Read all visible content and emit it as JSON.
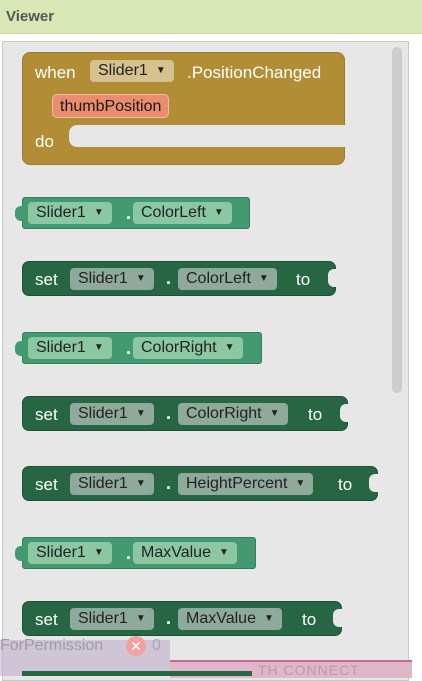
{
  "viewer": {
    "title": "Viewer"
  },
  "event_block": {
    "when": "when",
    "component": "Slider1",
    "event": ".PositionChanged",
    "param": "thumbPosition",
    "do": "do"
  },
  "blocks": [
    {
      "kind": "getter",
      "component": "Slider1",
      "property": "ColorLeft"
    },
    {
      "kind": "setter",
      "set": "set",
      "component": "Slider1",
      "property": "ColorLeft",
      "to": "to"
    },
    {
      "kind": "getter",
      "component": "Slider1",
      "property": "ColorRight"
    },
    {
      "kind": "setter",
      "set": "set",
      "component": "Slider1",
      "property": "ColorRight",
      "to": "to"
    },
    {
      "kind": "setter",
      "set": "set",
      "component": "Slider1",
      "property": "HeightPercent",
      "to": "to"
    },
    {
      "kind": "getter",
      "component": "Slider1",
      "property": "MaxValue"
    },
    {
      "kind": "setter",
      "set": "set",
      "component": "Slider1",
      "property": "MaxValue",
      "to": "to"
    }
  ],
  "bottom": {
    "label": "ForPermission",
    "warning_count": "0",
    "clipped_text": "TH CONNECT"
  },
  "colors": {
    "event": "#b18e35",
    "getter": "#439970",
    "setter": "#266643"
  }
}
